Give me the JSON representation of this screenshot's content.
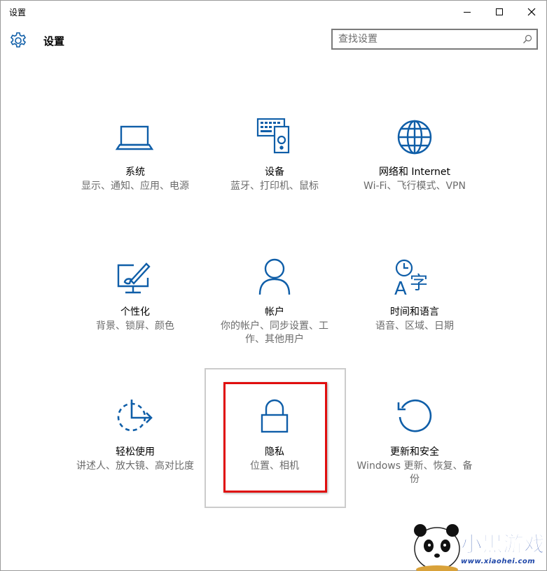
{
  "window": {
    "title": "设置"
  },
  "header": {
    "app_title": "设置",
    "search_placeholder": "查找设置"
  },
  "tiles": [
    {
      "name": "系统",
      "desc": "显示、通知、应用、电源",
      "icon": "laptop-icon"
    },
    {
      "name": "设备",
      "desc": "蓝牙、打印机、鼠标",
      "icon": "keyboard-speaker-icon"
    },
    {
      "name": "网络和 Internet",
      "desc": "Wi-Fi、飞行模式、VPN",
      "icon": "globe-icon"
    },
    {
      "name": "个性化",
      "desc": "背景、锁屏、颜色",
      "icon": "paint-monitor-icon"
    },
    {
      "name": "帐户",
      "desc": "你的帐户、同步设置、工作、其他用户",
      "icon": "person-icon"
    },
    {
      "name": "时间和语言",
      "desc": "语音、区域、日期",
      "icon": "time-language-icon"
    },
    {
      "name": "轻松使用",
      "desc": "讲述人、放大镜、高对比度",
      "icon": "ease-of-access-icon"
    },
    {
      "name": "隐私",
      "desc": "位置、相机",
      "icon": "lock-icon"
    },
    {
      "name": "更新和安全",
      "desc": "Windows 更新、恢复、备份",
      "icon": "refresh-icon"
    }
  ],
  "watermark": {
    "logo_text": "小黑游戏",
    "url": "www.xiaohei.com"
  },
  "colors": {
    "accent": "#0f5ea8",
    "highlight": "#e00e0e",
    "description": "#6b6b6b"
  }
}
